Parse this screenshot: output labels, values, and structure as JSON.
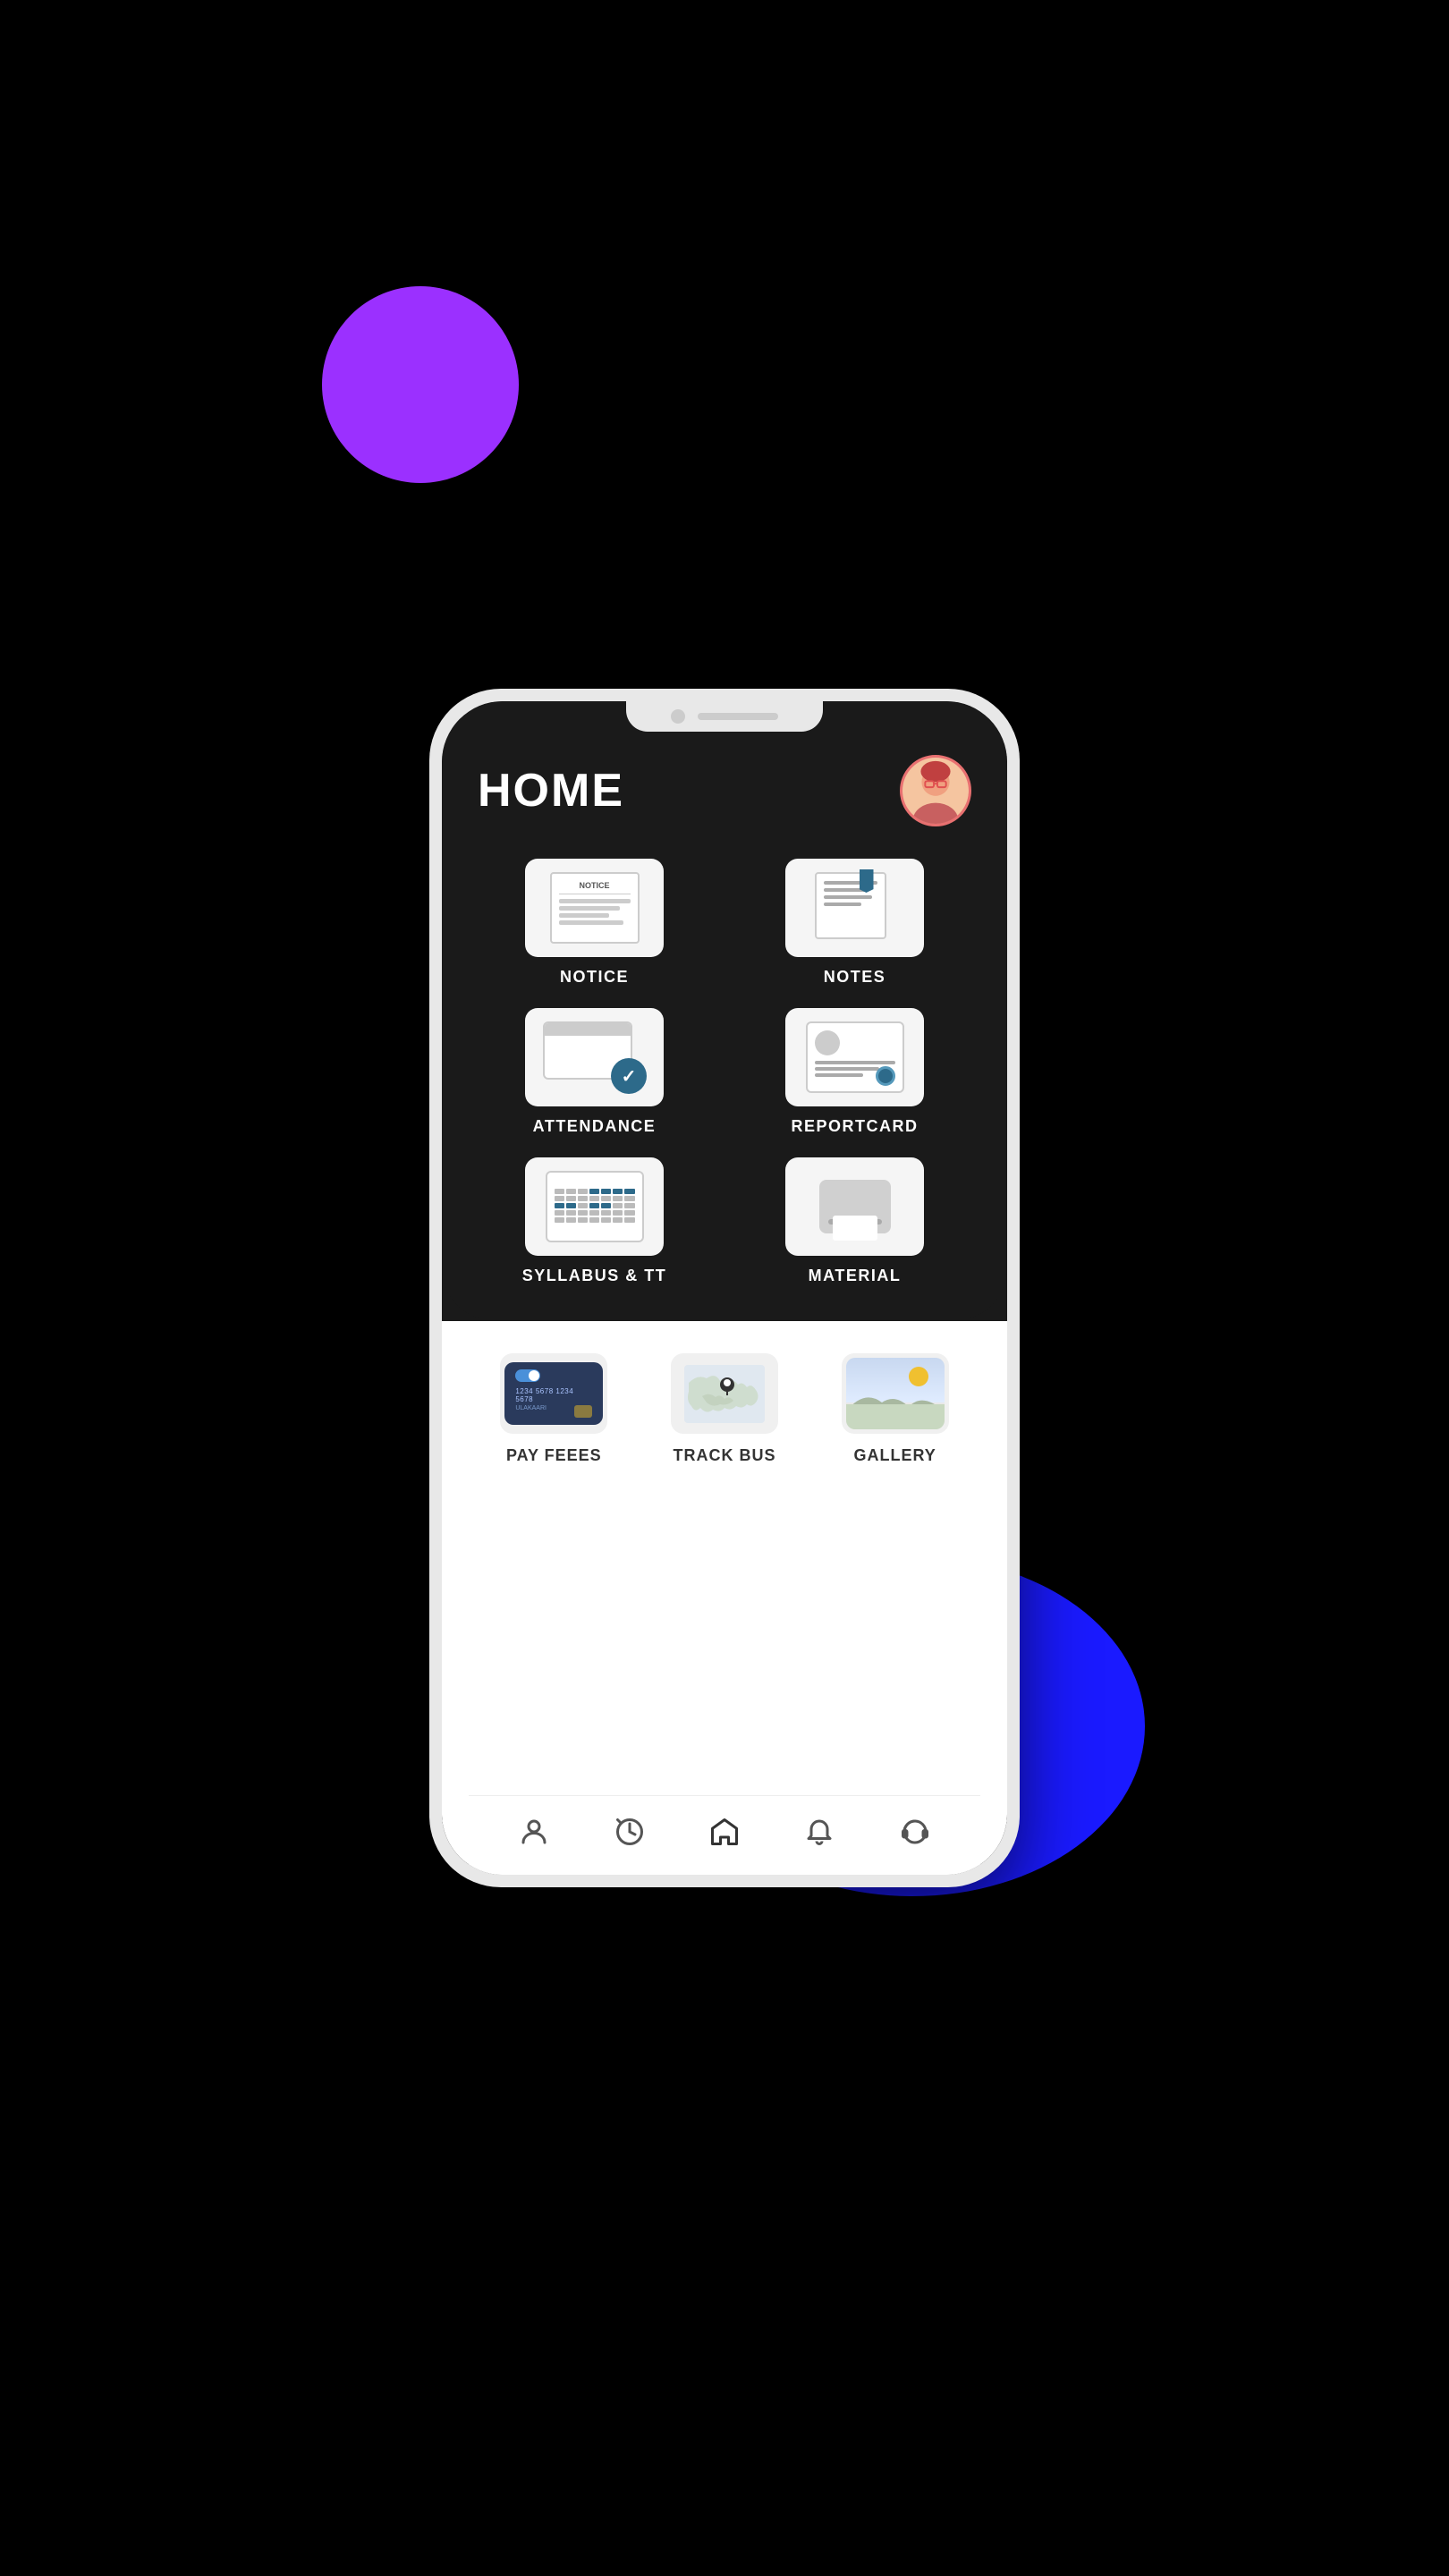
{
  "app": {
    "title": "HOME"
  },
  "menu_items": [
    {
      "id": "notice",
      "label": "NOTICE",
      "icon": "notice-icon"
    },
    {
      "id": "notes",
      "label": "NOTES",
      "icon": "notes-icon"
    },
    {
      "id": "attendance",
      "label": "ATTENDANCE",
      "icon": "attendance-icon"
    },
    {
      "id": "reportcard",
      "label": "REPORTCARD",
      "icon": "reportcard-icon"
    },
    {
      "id": "syllabus",
      "label": "SYLLABUS & TT",
      "icon": "syllabus-icon"
    },
    {
      "id": "material",
      "label": "MATERIAL",
      "icon": "material-icon"
    }
  ],
  "bottom_items": [
    {
      "id": "pay-fees",
      "label": "PAY FEEES",
      "icon": "payfees-icon"
    },
    {
      "id": "track-bus",
      "label": "TRACK BUS",
      "icon": "trackbus-icon"
    },
    {
      "id": "gallery",
      "label": "GALLERY",
      "icon": "gallery-icon"
    }
  ],
  "nav_items": [
    {
      "id": "profile",
      "icon": "person-icon"
    },
    {
      "id": "history",
      "icon": "clock-icon"
    },
    {
      "id": "home",
      "icon": "home-icon",
      "active": true
    },
    {
      "id": "notifications",
      "icon": "bell-icon"
    },
    {
      "id": "support",
      "icon": "headset-icon"
    }
  ],
  "notice_label": "NOTICE",
  "card_number": "1234 5678 1234 5678",
  "card_name": "ULAKAARI",
  "colors": {
    "dark_bg": "#1a1a1a",
    "white_bg": "#ffffff",
    "accent": "#2d6a8a",
    "purple_blob": "#9b30ff",
    "blue_blob": "#1a1aff"
  }
}
